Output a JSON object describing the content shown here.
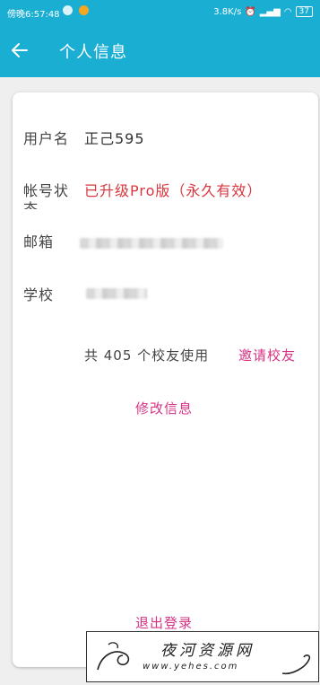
{
  "status_bar": {
    "time": "傍晚6:57:48",
    "net_speed": "3.8K/s",
    "battery": "37"
  },
  "app_bar": {
    "back_icon": "arrow-left-icon",
    "title": "个人信息"
  },
  "profile": {
    "username_label": "用户名",
    "username_value": "正己595",
    "account_status_label_line1": "帐号状",
    "account_status_label_line2": "态",
    "account_status_value": "已升级Pro版（永久有效）",
    "email_label": "邮箱",
    "school_label": "学校",
    "schoolmates_text": "共 405 个校友使用",
    "invite_label": "邀请校友",
    "edit_label": "修改信息",
    "logout_label": "退出登录"
  },
  "watermark": {
    "text": "夜河资源网",
    "url": "www.yehes.com"
  },
  "colors": {
    "primary": "#1aaed3",
    "accent_link": "#d63384",
    "status_red": "#d9363e"
  }
}
